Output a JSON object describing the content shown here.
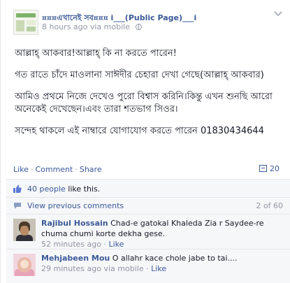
{
  "post": {
    "page_name": "¤¤¤এখানেই সব¤¤¤ i___(Public Page)___i",
    "time": "8 hours ago",
    "via": "via mobile",
    "paragraphs": [
      "আল্লাহ্‌ আকবার!আল্লাহ্‌ কি না করতে পারেন!",
      "গত রাতে চাঁদে মাওলানা সাঈদীর চেহারা দেখা গেছে(আল্লাহ্‌ আকবার)",
      "আমিও প্রথমে নিজে দেখেও পুরো বিশ্বাস করিনি।কিন্তু এখন শুনছি আরো অনেকেই দেখেছেন।এবং তারা শতভাগ সিওর।",
      "সন্দেহ থাকলে এই নাম্বারে যোগাযোগ করতে পারেন 01830434644"
    ]
  },
  "actions": {
    "like": "Like",
    "comment": "Comment",
    "share": "Share",
    "share_count": "20"
  },
  "likes": {
    "people": "40 people",
    "suffix": "like this."
  },
  "comments_nav": {
    "view_previous": "View previous comments",
    "count": "2 of 60"
  },
  "comments": [
    {
      "author": "Rajibul Hossain",
      "text": "Chad-e gatokal Khaleda Zia r Saydee-re chuma chumi korte dekha gese.",
      "time": "52 minutes ago",
      "like": "Like"
    },
    {
      "author": "Mehjabeen Mou",
      "text": "O allahr kace chole jabe to tai....",
      "time": "29 minutes ago",
      "via": "via mobile",
      "like": "Like"
    }
  ],
  "colors": {
    "link": "#3b5998",
    "meta": "#9197a3",
    "ufi_bg": "#f6f7f9"
  }
}
